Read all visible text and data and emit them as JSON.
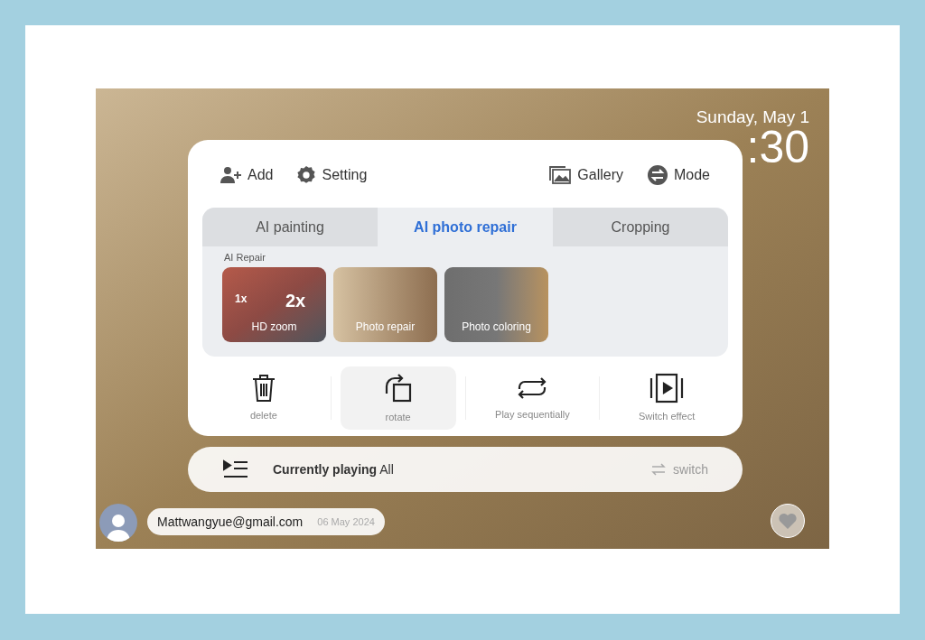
{
  "clock": {
    "date": "Sunday, May 1",
    "time": ":30"
  },
  "toolbar": {
    "left": [
      {
        "kind": "add",
        "label": "Add"
      },
      {
        "kind": "setting",
        "label": "Setting"
      }
    ],
    "right": [
      {
        "kind": "gallery",
        "label": "Gallery"
      },
      {
        "kind": "mode",
        "label": "Mode"
      }
    ]
  },
  "tabs": [
    {
      "label": "AI painting",
      "selected": false
    },
    {
      "label": "AI photo repair",
      "selected": true
    },
    {
      "label": "Cropping",
      "selected": false
    }
  ],
  "section_label": "AI Repair",
  "repair_options": [
    {
      "kind": "zoom",
      "label": "HD zoom",
      "badges": [
        "1x",
        "2x"
      ]
    },
    {
      "kind": "repair",
      "label": "Photo repair"
    },
    {
      "kind": "coloring",
      "label": "Photo coloring"
    }
  ],
  "actions": [
    {
      "kind": "delete",
      "label": "delete",
      "selected": false
    },
    {
      "kind": "rotate",
      "label": "rotate",
      "selected": true
    },
    {
      "kind": "sequential",
      "label": "Play sequentially",
      "selected": false
    },
    {
      "kind": "effect",
      "label": "Switch effect",
      "selected": false
    }
  ],
  "now_playing": {
    "text": "**Currently playing** All",
    "switch": "switch"
  },
  "user": {
    "email": "Mattwangyue@gmail.com",
    "date": "06 May 2024"
  }
}
